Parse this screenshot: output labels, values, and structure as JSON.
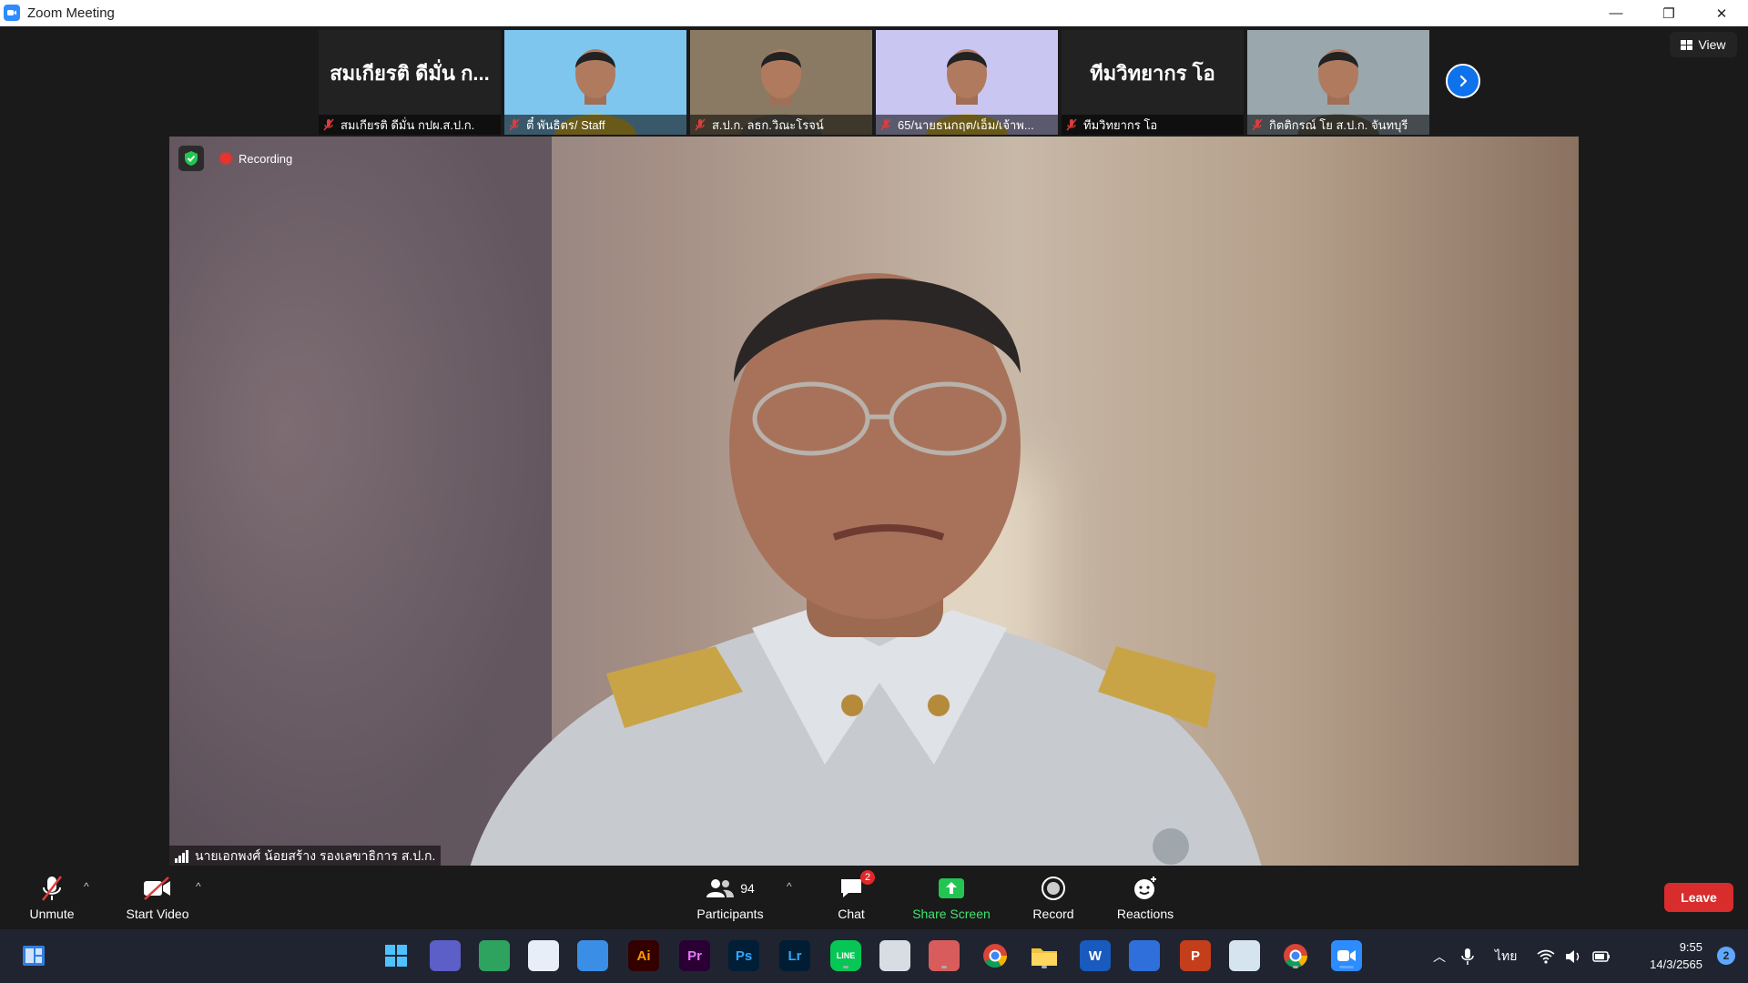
{
  "window": {
    "title": "Zoom Meeting",
    "controls": {
      "minimize": "—",
      "restore": "❐",
      "close": "✕"
    }
  },
  "gallery": {
    "view_label": "View",
    "tiles": [
      {
        "type": "name",
        "big_name": "สมเกียรติ ดีมั่น ก...",
        "caption": "สมเกียรติ ดีมั่น กปผ.ส.ป.ก."
      },
      {
        "type": "video",
        "caption": "ตี๋ พันธิตร/ Staff",
        "bg": "#7fc6ee",
        "shirt": "#e9c73a"
      },
      {
        "type": "video",
        "caption": "ส.ป.ก. ลธก.วิณะโรจน์",
        "bg": "#8b7a63",
        "shirt": "#6e6a60"
      },
      {
        "type": "video",
        "caption": "65/นายธนกฤต/เอ็ม/เจ้าพ...",
        "bg": "#c9c6f2",
        "shirt": "#e6c63b"
      },
      {
        "type": "name",
        "big_name": "ทีมวิทยากร โอ",
        "caption": "ทีมวิทยากร โอ"
      },
      {
        "type": "video",
        "caption": "กิตติกรณ์ โย ส.ป.ก. จันทบุรี",
        "bg": "#9aa7ad",
        "shirt": "#6f6c5a"
      }
    ]
  },
  "main_video": {
    "recording_label": "Recording",
    "speaker_name": "นายเอกพงศ์ น้อยสร้าง รองเลขาธิการ ส.ป.ก."
  },
  "toolbar": {
    "unmute": "Unmute",
    "start_video": "Start Video",
    "participants": "Participants",
    "participants_count": "94",
    "chat": "Chat",
    "chat_badge": "2",
    "share_screen": "Share Screen",
    "record": "Record",
    "reactions": "Reactions",
    "leave": "Leave"
  },
  "taskbar": {
    "pinned_apps": [
      {
        "name": "start-icon",
        "label": "",
        "color": "#1f2430"
      },
      {
        "name": "teams-chat-icon",
        "label": "",
        "color": "#5b5fc7"
      },
      {
        "name": "notes-icon",
        "label": "",
        "color": "#2ea35f"
      },
      {
        "name": "store-icon",
        "label": "",
        "color": "#e7eef8"
      },
      {
        "name": "outlook-icon",
        "label": "",
        "color": "#3a8ee6"
      },
      {
        "name": "illustrator-icon",
        "label": "Ai",
        "color": "#330000"
      },
      {
        "name": "premiere-icon",
        "label": "Pr",
        "color": "#2a0034"
      },
      {
        "name": "photoshop-icon",
        "label": "Ps",
        "color": "#001e36"
      },
      {
        "name": "lightroom-icon",
        "label": "Lr",
        "color": "#001d34"
      },
      {
        "name": "line-icon",
        "label": "LINE",
        "color": "#06c755"
      },
      {
        "name": "screen-icon",
        "label": "",
        "color": "#d7dde3"
      },
      {
        "name": "snipping-icon",
        "label": "",
        "color": "#d95c5c"
      },
      {
        "name": "chrome-icon",
        "label": "",
        "color": "#e8e8e8"
      },
      {
        "name": "explorer-icon",
        "label": "",
        "color": "#f2c23a"
      },
      {
        "name": "word-icon",
        "label": "W",
        "color": "#185abd"
      },
      {
        "name": "browser-icon",
        "label": "",
        "color": "#2f6fdc"
      },
      {
        "name": "powerpoint-icon",
        "label": "P",
        "color": "#c43e1c"
      },
      {
        "name": "monitor-icon",
        "label": "",
        "color": "#d6e4f0"
      },
      {
        "name": "chrome-alt-icon",
        "label": "",
        "color": "#e8e8e8"
      },
      {
        "name": "zoom-icon",
        "label": "",
        "color": "#2d8cff"
      }
    ],
    "language": "ไทย",
    "time": "9:55",
    "date": "14/3/2565",
    "notifications": "2"
  }
}
